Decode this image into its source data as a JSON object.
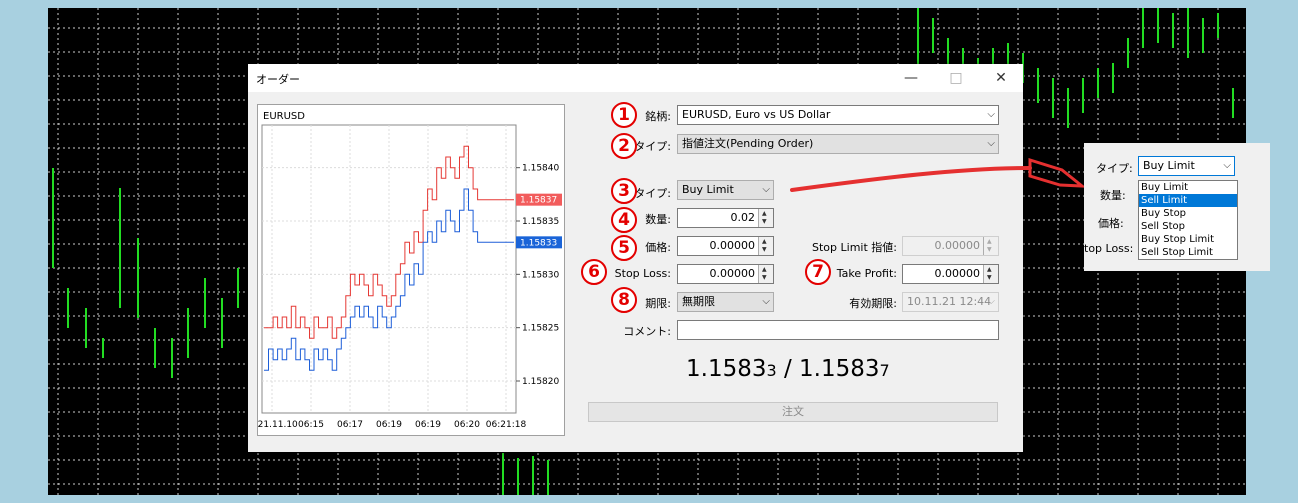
{
  "dialog": {
    "title": "オーダー",
    "minimize": "—",
    "maximize": "□",
    "close": "✕"
  },
  "chart": {
    "symbol": "EURUSD",
    "y_labels": [
      "1.15840",
      "1.15835",
      "1.15830",
      "1.15825",
      "1.15820"
    ],
    "x_labels": [
      "2021.11.10",
      "06:15",
      "06:17",
      "06:19",
      "06:19",
      "06:20",
      "06:21:18"
    ],
    "ask_tag": "1.15837",
    "bid_tag": "1.15833",
    "ask_color": "#f25c5c",
    "bid_color": "#1a64d8"
  },
  "chart_data": {
    "type": "line",
    "ylim": [
      1.15817,
      1.15844
    ],
    "series": [
      {
        "color": "#e53935",
        "values": [
          1.15825,
          1.15825,
          1.15826,
          1.15825,
          1.15826,
          1.15825,
          1.15827,
          1.15825,
          1.15826,
          1.15825,
          1.15824,
          1.15826,
          1.15825,
          1.15825,
          1.15826,
          1.15824,
          1.15825,
          1.15826,
          1.15828,
          1.1583,
          1.15829,
          1.1583,
          1.15829,
          1.15828,
          1.1583,
          1.15829,
          1.15828,
          1.15827,
          1.15828,
          1.1583,
          1.15831,
          1.15833,
          1.15832,
          1.15834,
          1.15833,
          1.15836,
          1.15838,
          1.15837,
          1.1584,
          1.15839,
          1.15841,
          1.1584,
          1.15839,
          1.15841,
          1.15842,
          1.1584,
          1.15838,
          1.15837,
          1.15837,
          1.15837,
          1.15837,
          1.15837,
          1.15837,
          1.15837,
          1.15837,
          1.15837
        ]
      },
      {
        "color": "#1e5fd8",
        "values": [
          1.15821,
          1.15823,
          1.15822,
          1.15823,
          1.15822,
          1.15823,
          1.15824,
          1.15822,
          1.15823,
          1.15822,
          1.15821,
          1.15823,
          1.15822,
          1.15823,
          1.15822,
          1.15821,
          1.15823,
          1.15824,
          1.15825,
          1.15826,
          1.15827,
          1.15826,
          1.15827,
          1.15826,
          1.15825,
          1.15827,
          1.15826,
          1.15825,
          1.15826,
          1.15827,
          1.15828,
          1.1583,
          1.15829,
          1.15831,
          1.1583,
          1.15833,
          1.15834,
          1.15833,
          1.15835,
          1.15834,
          1.15836,
          1.15835,
          1.15834,
          1.15836,
          1.15838,
          1.15836,
          1.15834,
          1.15833,
          1.15833,
          1.15833,
          1.15833,
          1.15833,
          1.15833,
          1.15833,
          1.15833,
          1.15833
        ]
      }
    ]
  },
  "form": {
    "symbol_label": "銘柄:",
    "symbol_value": "EURUSD, Euro vs US Dollar",
    "type_label": "タイプ:",
    "type_value": "指値注文(Pending Order)",
    "order_type_label": "タイプ:",
    "order_type_value": "Buy Limit",
    "volume_label": "数量:",
    "volume_value": "0.02",
    "price_label": "価格:",
    "price_value": "0.00000",
    "stop_limit_label": "Stop Limit 指値:",
    "stop_limit_value": "0.00000",
    "sl_label": "Stop Loss:",
    "sl_value": "0.00000",
    "tp_label": "Take Profit:",
    "tp_value": "0.00000",
    "expiry_label": "期限:",
    "expiry_value": "無期限",
    "expiry_date_label": "有効期限:",
    "expiry_date_value": "10.11.21 12:44",
    "comment_label": "コメント:",
    "comment_value": "",
    "bid_main": "1.1583",
    "bid_small": "3",
    "separator": " / ",
    "ask_main": "1.1583",
    "ask_small": "7",
    "order_button": "注文"
  },
  "callouts": [
    "1",
    "2",
    "3",
    "4",
    "5",
    "6",
    "7",
    "8"
  ],
  "popup": {
    "type_label": "タイプ:",
    "type_value": "Buy Limit",
    "volume_label": "数量:",
    "price_label": "価格:",
    "sl_label": "top Loss:",
    "options": [
      "Buy Limit",
      "Sell Limit",
      "Buy Stop",
      "Sell Stop",
      "Buy Stop Limit",
      "Sell Stop Limit"
    ],
    "selected_index": 1
  },
  "colors": {
    "callout": "#e30000",
    "grid": "#ffffff",
    "candles": "#22dd22",
    "selection": "#0078d7"
  }
}
